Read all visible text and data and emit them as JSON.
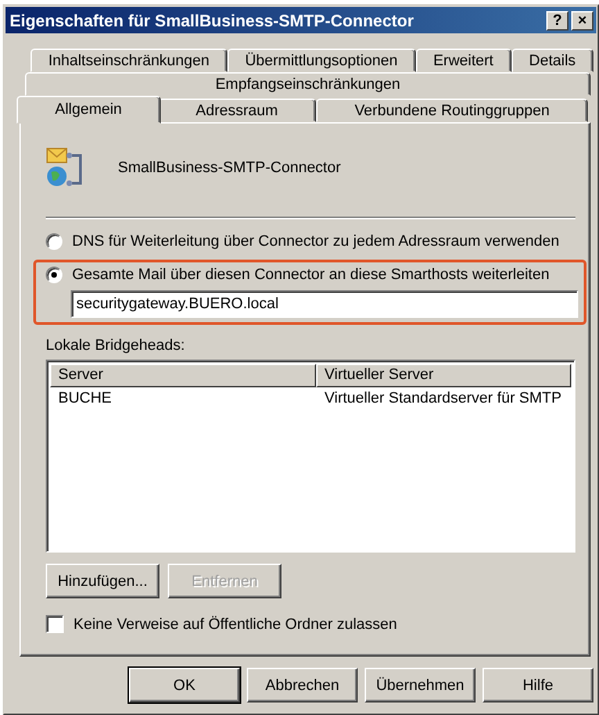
{
  "window": {
    "title": "Eigenschaften für SmallBusiness-SMTP-Connector",
    "help_button": "?",
    "close_button": "×"
  },
  "tab_rows": [
    [
      {
        "label": "Inhaltseinschränkungen",
        "selected": false
      },
      {
        "label": "Übermittlungsoptionen",
        "selected": false
      },
      {
        "label": "Erweitert",
        "selected": false
      },
      {
        "label": "Details",
        "selected": false
      }
    ],
    [
      {
        "label": "Empfangseinschränkungen",
        "selected": false
      }
    ],
    [
      {
        "label": "Allgemein",
        "selected": true
      },
      {
        "label": "Adressraum",
        "selected": false
      },
      {
        "label": "Verbundene Routinggruppen",
        "selected": false
      }
    ]
  ],
  "connector": {
    "name": "SmallBusiness-SMTP-Connector"
  },
  "routing": {
    "options": [
      {
        "label": "DNS für Weiterleitung über Connector zu jedem Adressraum verwenden",
        "selected": false,
        "highlighted": false
      },
      {
        "label": "Gesamte Mail über diesen Connector an diese Smarthosts weiterleiten",
        "selected": true,
        "highlighted": true
      }
    ],
    "smarthost": "securitygateway.BUERO.local"
  },
  "bridgeheads": {
    "label": "Lokale Bridgeheads:",
    "columns": [
      "Server",
      "Virtueller Server"
    ],
    "rows": [
      [
        "BUCHE",
        "Virtueller Standardserver für SMTP"
      ]
    ]
  },
  "list_buttons": [
    {
      "label": "Hinzufügen...",
      "disabled": false
    },
    {
      "label": "Entfernen",
      "disabled": true
    }
  ],
  "public_folders": {
    "label": "Keine Verweise auf Öffentliche Ordner zulassen",
    "checked": false
  },
  "footer_buttons": [
    {
      "label": "OK",
      "default": true
    },
    {
      "label": "Abbrechen",
      "default": false
    },
    {
      "label": "Übernehmen",
      "default": false
    },
    {
      "label": "Hilfe",
      "default": false
    }
  ]
}
